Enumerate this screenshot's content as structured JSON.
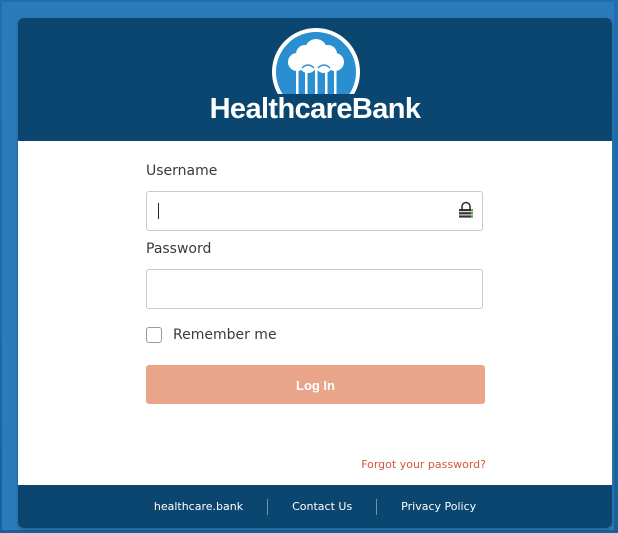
{
  "brand": {
    "name": "HealthcareBank",
    "logo_icon": "trees-in-circle-icon"
  },
  "login_form": {
    "username_label": "Username",
    "username_value": "",
    "username_icon": "password-manager-key-icon",
    "password_label": "Password",
    "password_value": "",
    "remember_label": "Remember me",
    "remember_checked": false,
    "login_label": "Log In",
    "forgot_label": "Forgot your password?"
  },
  "footer": {
    "links": [
      "healthcare.bank",
      "Contact Us",
      "Privacy Policy"
    ]
  },
  "colors": {
    "header_bg": "#0b4670",
    "page_bg": "#1f6fae",
    "login_button": "#e8a58a",
    "forgot_link": "#d2573a"
  }
}
